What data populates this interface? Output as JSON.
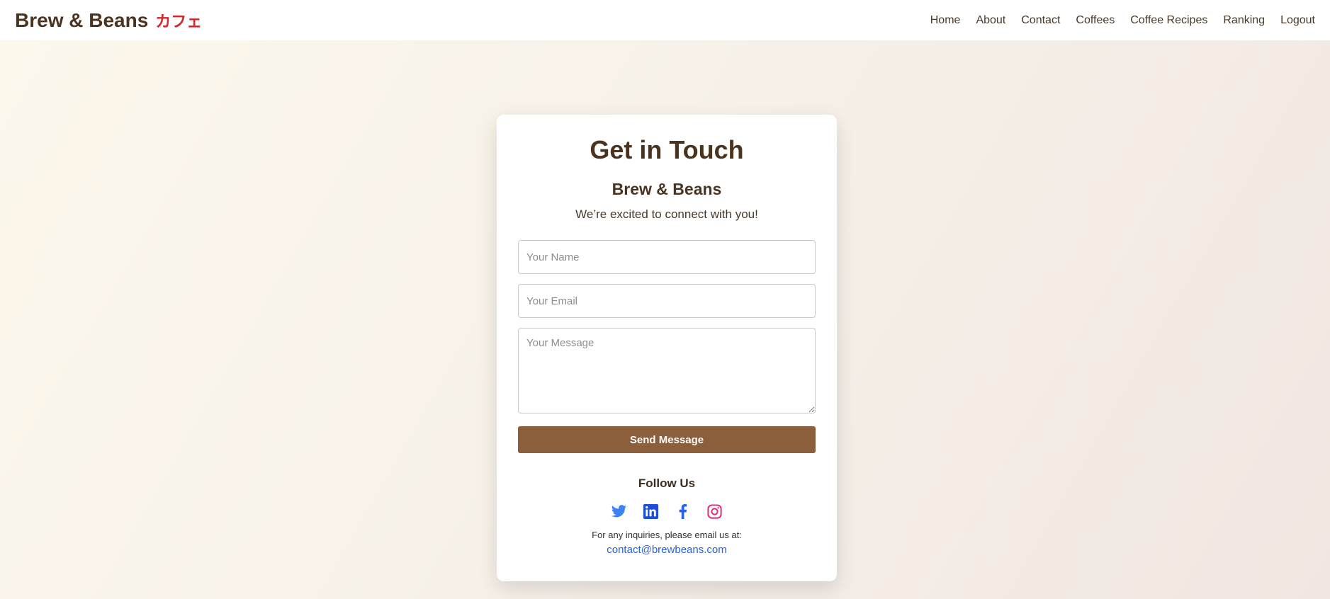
{
  "brand": {
    "name": "Brew & Beans",
    "tagline_jp": "カフェ"
  },
  "nav": {
    "items": [
      {
        "label": "Home"
      },
      {
        "label": "About"
      },
      {
        "label": "Contact"
      },
      {
        "label": "Coffees"
      },
      {
        "label": "Coffee Recipes"
      },
      {
        "label": "Ranking"
      },
      {
        "label": "Logout"
      }
    ]
  },
  "card": {
    "title": "Get in Touch",
    "subtitle": "Brew & Beans",
    "tagline": "We’re excited to connect with you!",
    "form": {
      "name_placeholder": "Your Name",
      "email_placeholder": "Your Email",
      "message_placeholder": "Your Message",
      "submit_label": "Send Message"
    },
    "follow_label": "Follow Us",
    "socials": [
      {
        "icon": "twitter-icon",
        "color": "#3b82f6"
      },
      {
        "icon": "linkedin-icon",
        "color": "#1d4ed8"
      },
      {
        "icon": "facebook-icon",
        "color": "#2563eb"
      },
      {
        "icon": "instagram-icon",
        "color": "#db2777"
      }
    ],
    "inquiry_text": "For any inquiries, please email us at:",
    "email": "contact@brewbeans.com"
  },
  "colors": {
    "accent": "#8b5e3c",
    "brand_text": "#4a3420",
    "brand_jp": "#d0282e",
    "link": "#2b5fd6"
  }
}
